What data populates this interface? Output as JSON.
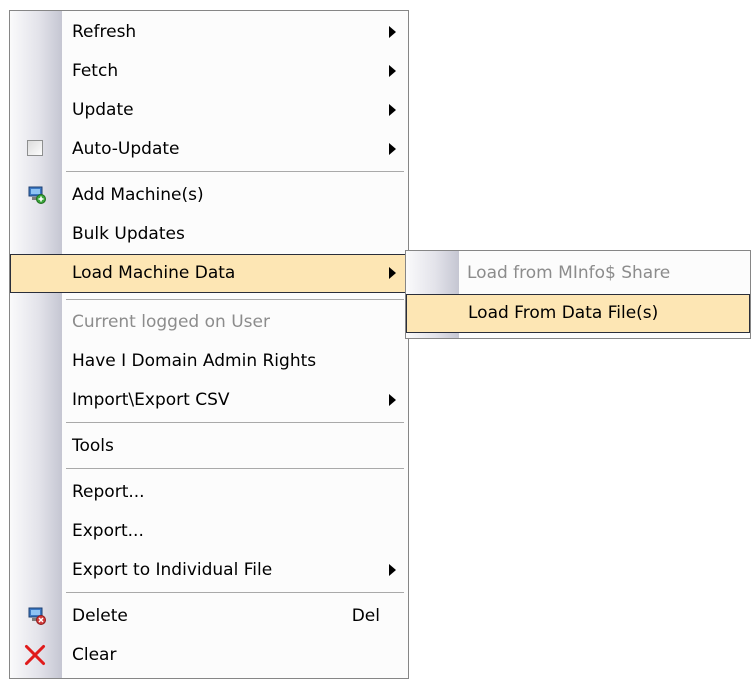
{
  "main_menu": {
    "items": [
      {
        "label": "Refresh"
      },
      {
        "label": "Fetch"
      },
      {
        "label": "Update"
      },
      {
        "label": "Auto-Update"
      },
      {
        "label": "Add Machine(s)"
      },
      {
        "label": "Bulk Updates"
      },
      {
        "label": "Load Machine Data"
      },
      {
        "label": "Current logged on User"
      },
      {
        "label": "Have I Domain Admin Rights"
      },
      {
        "label": "Import\\Export CSV"
      },
      {
        "label": "Tools"
      },
      {
        "label": "Report..."
      },
      {
        "label": "Export..."
      },
      {
        "label": "Export to Individual File"
      },
      {
        "label": "Delete",
        "shortcut": "Del"
      },
      {
        "label": "Clear"
      }
    ]
  },
  "submenu": {
    "items": [
      {
        "label": "Load from MInfo$ Share"
      },
      {
        "label": "Load From Data File(s)"
      }
    ]
  },
  "colors": {
    "highlight": "#fde6b4",
    "disabled_text": "#8c8c8c"
  },
  "icons": {
    "auto_update": "checkbox-icon",
    "add_machine": "computer-add-icon",
    "delete": "computer-delete-icon",
    "clear": "red-x-icon"
  }
}
